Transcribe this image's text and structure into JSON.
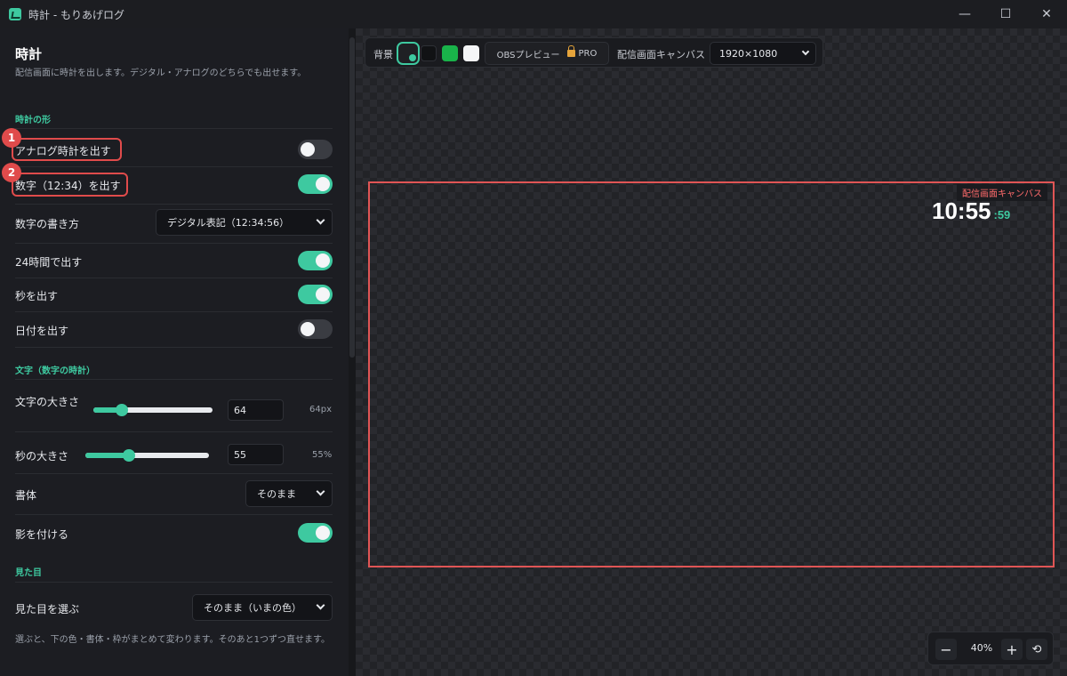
{
  "window": {
    "title": "時計 - もりあげログ",
    "controls": {
      "minimize": "—",
      "maximize": "☐",
      "close": "✕"
    }
  },
  "panel": {
    "title": "時計",
    "description": "配信画面に時計を出します。デジタル・アナログのどちらでも出せます。",
    "sections": {
      "shape": "時計の形",
      "text": "文字（数字の時計）",
      "look": "見た目"
    },
    "rows": {
      "analog": {
        "label": "アナログ時計を出す",
        "on": false
      },
      "digital": {
        "label": "数字（12:34）を出す",
        "on": true
      },
      "format": {
        "label": "数字の書き方",
        "value": "デジタル表記（12:34:56）"
      },
      "h24": {
        "label": "24時間で出す",
        "on": true
      },
      "seconds": {
        "label": "秒を出す",
        "on": true
      },
      "date": {
        "label": "日付を出す",
        "on": false
      },
      "text_size": {
        "label": "文字の大きさ",
        "value": "64",
        "unit": "64px",
        "level": 0.24
      },
      "sec_size": {
        "label": "秒の大きさ",
        "value": "55",
        "unit": "55%",
        "level": 0.35
      },
      "font": {
        "label": "書体",
        "value": "そのまま"
      },
      "shadow": {
        "label": "影を付ける",
        "on": true
      },
      "theme": {
        "label": "見た目を選ぶ",
        "value": "そのまま（いまの色）"
      }
    },
    "footnote": "選ぶと、下の色・書体・枠がまとめて変わります。そのあと1つずつ直せます。",
    "badges": [
      "1",
      "2"
    ]
  },
  "toolbar": {
    "bg_label": "背景",
    "swatches": [
      "#1f2024",
      "#111214",
      "#19b34a",
      "#f4f5f7"
    ],
    "obs_label": "OBSプレビュー",
    "pro_label": "PRO",
    "canvas_label": "配信画面キャンバス",
    "resolution": "1920×1080"
  },
  "canvas": {
    "tag": "配信画面キャンバス",
    "time_main": "10:55",
    "time_sec": ":59"
  },
  "zoom": {
    "minus": "−",
    "value": "40%",
    "plus": "+",
    "reset": "⟲"
  }
}
